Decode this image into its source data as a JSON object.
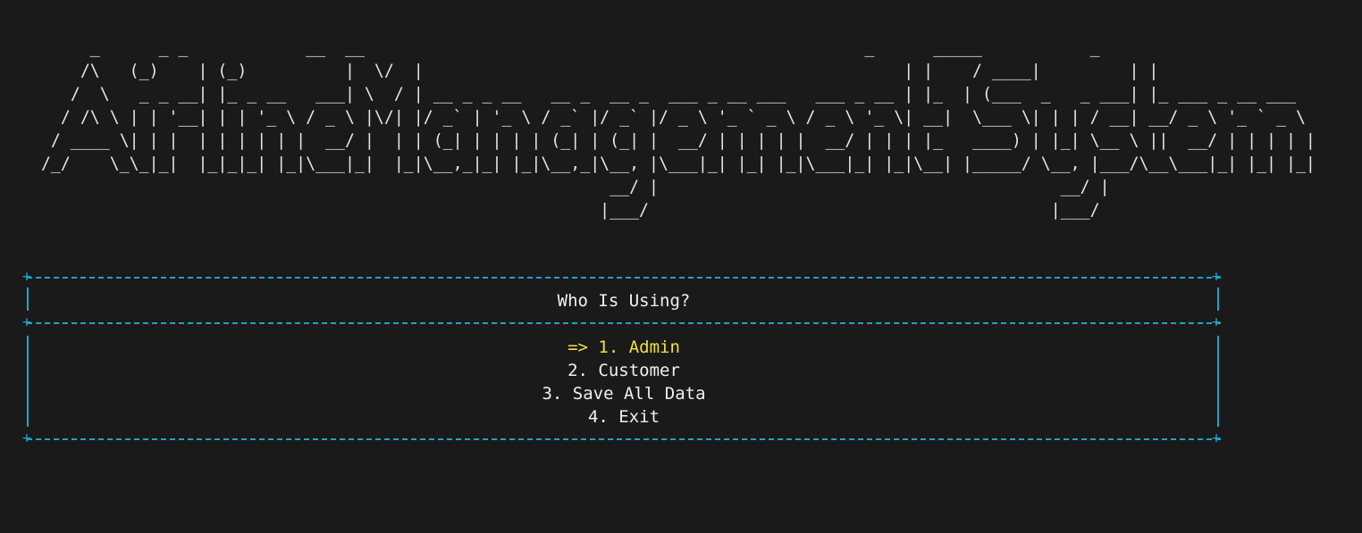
{
  "banner_art": "       _      _ _            __  __                                                   _      _____           _                 \n      /\\   (_)    | (_)          |  \\/  |                                                 | |    / ____|         | |                \n     /  \\   _ _ __| |_ _ __   ___| \\  / | __ _ _ __   __ _  __ _  ___ _ __ ___   ___ _ __ | |_  | (___  _   _ ___| |_ ___ _ __ ___   \n    / /\\ \\ | | '__| | | '_ \\ / _ \\ |\\/| |/ _` | '_ \\ / _` |/ _` |/ _ \\ '_ ` _ \\ / _ \\ '_ \\| __|  \\___ \\| | | / __| __/ _ \\ '_ ` _ \\  \n   / ____ \\| | |  | | | | | |  __/ |  | | (_| | | | | (_| | (_| |  __/ | | | | |  __/ | | | |_   ____) | |_| \\__ \\ ||  __/ | | | | | \n  /_/    \\_\\_|_|  |_|_|_| |_|\\___|_|  |_|\\__,_|_| |_|\\__,_|\\__, |\\___|_| |_| |_|\\___|_| |_|\\__| |_____/ \\__, |___/\\__\\___|_| |_| |_| \n                                                            __/ |                                         __/ |                       \n                                                           |___/                                         |___/                        ",
  "prompt": {
    "title": "Who Is Using?"
  },
  "menu": {
    "items": [
      {
        "label": "=> 1. Admin",
        "selected": true
      },
      {
        "label": "2. Customer",
        "selected": false
      },
      {
        "label": "3. Save All Data",
        "selected": false
      },
      {
        "label": "4. Exit",
        "selected": false
      }
    ]
  },
  "colors": {
    "background": "#1a1a1a",
    "border": "#1ba3c9",
    "text": "#f0f0f0",
    "highlight": "#f0e03c"
  },
  "glyphs": {
    "corner": "+"
  }
}
